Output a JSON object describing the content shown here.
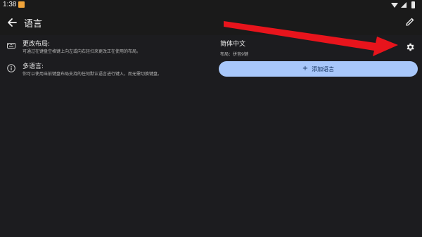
{
  "status_bar": {
    "time": "1:38"
  },
  "toolbar": {
    "title": "语言"
  },
  "rows": [
    {
      "title": "更改布局:",
      "subtitle": "可通过在键盘空格键上向左或向右轻扫来更改正在使用的布局。",
      "icon": "keyboard-icon"
    },
    {
      "title": "多语言:",
      "subtitle": "你可以使用当前键盘布局支持的任何默认语言进行键入，而无需切换键盘。",
      "icon": "info-icon"
    }
  ],
  "language": {
    "name": "简体中文",
    "layout": "布局：拼音9键",
    "settings_icon": "gear-icon"
  },
  "add_button": {
    "label": "添加语言",
    "plus": "+"
  },
  "colors": {
    "background": "#1c1c1f",
    "accent_button": "#a8c7fa",
    "annotation_arrow": "#e8141c"
  }
}
